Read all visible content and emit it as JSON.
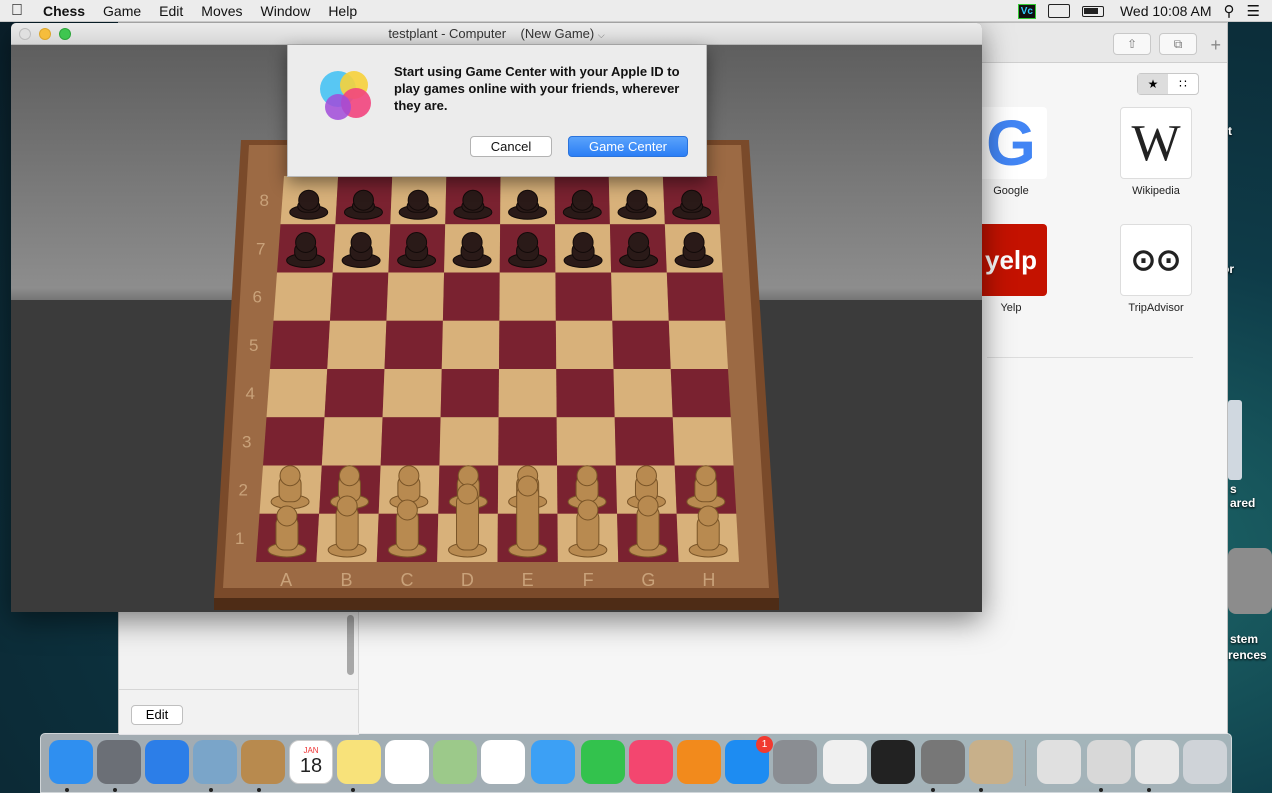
{
  "menubar": {
    "app_name": "Chess",
    "items": [
      "Game",
      "Edit",
      "Moves",
      "Window",
      "Help"
    ],
    "clock": "Wed 10:08 AM",
    "status_icon_text": "Vc"
  },
  "chess_window": {
    "title": "testplant - Computer",
    "subtitle": "(New Game)",
    "files": [
      "A",
      "B",
      "C",
      "D",
      "E",
      "F",
      "G",
      "H"
    ],
    "ranks": [
      "8",
      "7",
      "6",
      "5",
      "4",
      "3",
      "2",
      "1"
    ]
  },
  "dialog": {
    "message": "Start using Game Center with your Apple ID to play games online with your friends, wherever they are.",
    "cancel_label": "Cancel",
    "confirm_label": "Game Center"
  },
  "safari": {
    "favorites": [
      {
        "label": "Google",
        "glyph": "G"
      },
      {
        "label": "Wikipedia",
        "glyph": "W"
      },
      {
        "label": "Yelp",
        "glyph": "yelp"
      },
      {
        "label": "TripAdvisor",
        "glyph": "⊙⊙"
      }
    ],
    "edit_label": "Edit"
  },
  "desktop_labels": [
    "t",
    "or",
    "s",
    "ared",
    "stem",
    "rences"
  ],
  "dock": {
    "calendar_month": "JAN",
    "calendar_day": "18",
    "appstore_badge": "1",
    "items": [
      {
        "name": "finder",
        "color": "#2f8ff0"
      },
      {
        "name": "launchpad",
        "color": "#6b6f76"
      },
      {
        "name": "safari",
        "color": "#2c7ee8"
      },
      {
        "name": "mail-preview",
        "color": "#7aa5c9"
      },
      {
        "name": "contacts",
        "color": "#b88a4e"
      },
      {
        "name": "calendar",
        "color": "#ffffff"
      },
      {
        "name": "notes",
        "color": "#f8e27a"
      },
      {
        "name": "reminders",
        "color": "#ffffff"
      },
      {
        "name": "maps",
        "color": "#9cc98a"
      },
      {
        "name": "photos",
        "color": "#ffffff"
      },
      {
        "name": "messages",
        "color": "#3ca0f5"
      },
      {
        "name": "facetime",
        "color": "#33c24d"
      },
      {
        "name": "itunes",
        "color": "#f3466f"
      },
      {
        "name": "ibooks",
        "color": "#f28a1c"
      },
      {
        "name": "app-store",
        "color": "#1d8cf2"
      },
      {
        "name": "system-preferences",
        "color": "#8a8d92"
      },
      {
        "name": "textedit",
        "color": "#f0f0f0"
      },
      {
        "name": "activity-monitor",
        "color": "#222"
      },
      {
        "name": "calculator",
        "color": "#777"
      },
      {
        "name": "chess",
        "color": "#c8b08a"
      },
      {
        "name": "documents",
        "color": "#e0e0e0"
      },
      {
        "name": "downloads",
        "color": "#d8d8d8"
      },
      {
        "name": "screenshots",
        "color": "#e8e8e8"
      },
      {
        "name": "trash",
        "color": "#cfd3d8"
      }
    ]
  }
}
